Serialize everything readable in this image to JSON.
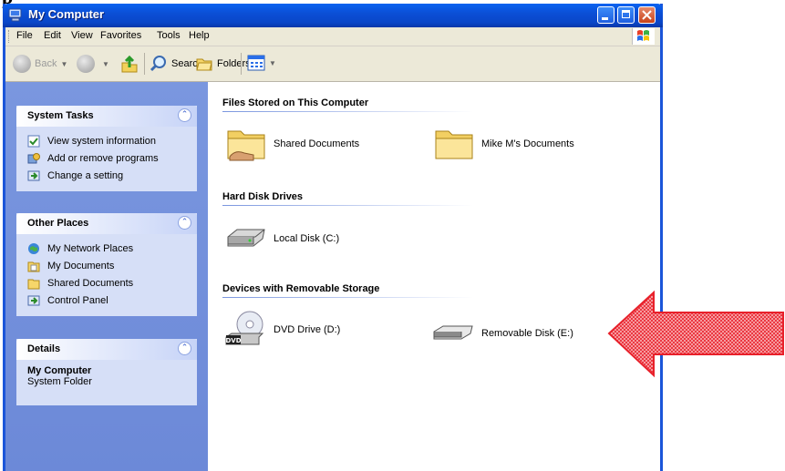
{
  "fragment": "p",
  "window": {
    "title": "My Computer",
    "controls": {
      "minimize": "_",
      "maximize": "□",
      "close": "✕"
    }
  },
  "menu": [
    "File",
    "Edit",
    "View",
    "Favorites",
    "Tools",
    "Help"
  ],
  "toolbar": {
    "back": "Back",
    "search": "Search",
    "folders": "Folders"
  },
  "sidebar": {
    "system_tasks": {
      "title": "System Tasks",
      "items": [
        "View system information",
        "Add or remove programs",
        "Change a setting"
      ]
    },
    "other_places": {
      "title": "Other Places",
      "items": [
        "My Network Places",
        "My Documents",
        "Shared Documents",
        "Control Panel"
      ]
    },
    "details": {
      "title": "Details",
      "name": "My Computer",
      "type": "System Folder"
    }
  },
  "groups": {
    "files": {
      "title": "Files Stored on This Computer",
      "items": [
        "Shared Documents",
        "Mike M's Documents"
      ]
    },
    "hard_disks": {
      "title": "Hard Disk Drives",
      "items": [
        "Local Disk (C:)"
      ]
    },
    "removable": {
      "title": "Devices with Removable Storage",
      "items": [
        "DVD Drive (D:)",
        "Removable Disk (E:)"
      ]
    }
  },
  "dvd_badge": "DVD",
  "colors": {
    "titlebar": "#0a46c8",
    "sidebar": "#6c89d8",
    "arrow": "#e8202a"
  }
}
